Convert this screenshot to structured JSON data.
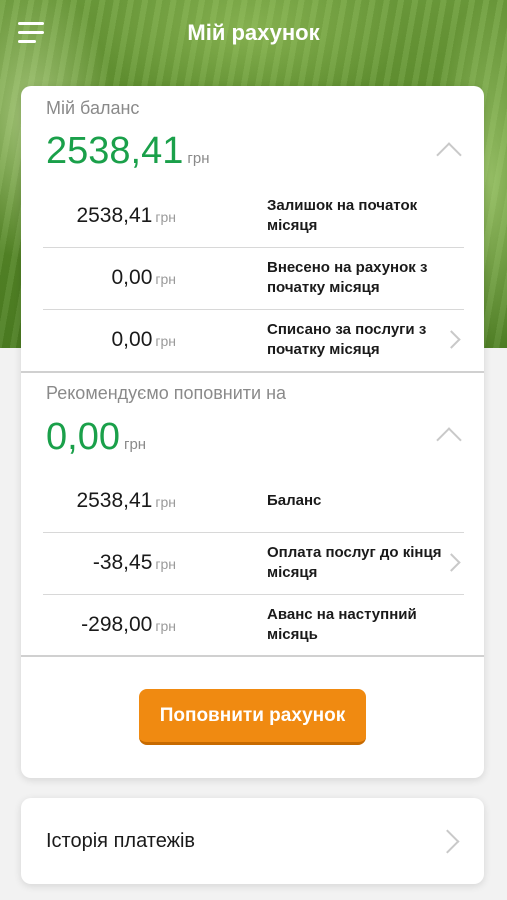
{
  "header": {
    "title": "Мій рахунок"
  },
  "balance": {
    "title": "Мій баланс",
    "amount": "2538,41",
    "currency": "грн",
    "rows": [
      {
        "amount": "2538,41",
        "currency": "грн",
        "label": "Залишок на початок місяця",
        "has_chevron": false
      },
      {
        "amount": "0,00",
        "currency": "грн",
        "label": "Внесено на рахунок з початку місяця",
        "has_chevron": false
      },
      {
        "amount": "0,00",
        "currency": "грн",
        "label": "Списано за послуги з початку місяця",
        "has_chevron": true
      }
    ]
  },
  "recommend": {
    "title": "Рекомендуємо поповнити на",
    "amount": "0,00",
    "currency": "грн",
    "rows": [
      {
        "amount": "2538,41",
        "currency": "грн",
        "label": "Баланс",
        "has_chevron": false
      },
      {
        "amount": "-38,45",
        "currency": "грн",
        "label": "Оплата послуг до кінця місяця",
        "has_chevron": true
      },
      {
        "amount": "-298,00",
        "currency": "грн",
        "label": "Аванс на наступний місяць",
        "has_chevron": false
      }
    ]
  },
  "actions": {
    "topup_label": "Поповнити рахунок"
  },
  "history": {
    "label": "Історія платежів"
  },
  "colors": {
    "accent_green": "#1aa04a",
    "button_orange": "#f08a11"
  }
}
